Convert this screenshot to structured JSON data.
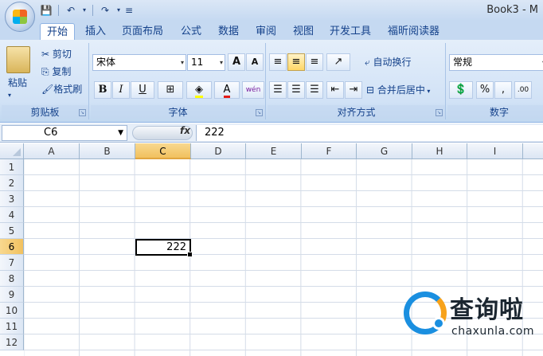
{
  "window": {
    "title": "Book3 - M"
  },
  "qat": {
    "save_icon": "save-icon",
    "undo_icon": "undo-icon",
    "redo_icon": "redo-icon"
  },
  "tabs": [
    "开始",
    "插入",
    "页面布局",
    "公式",
    "数据",
    "审阅",
    "视图",
    "开发工具",
    "福昕阅读器"
  ],
  "clipboard": {
    "paste": "粘贴",
    "cut": "剪切",
    "copy": "复制",
    "format_painter": "格式刷",
    "label": "剪贴板"
  },
  "font": {
    "name": "宋体",
    "size": "11",
    "label": "字体",
    "bold": "B",
    "italic": "I",
    "underline": "U",
    "grow": "A",
    "shrink": "A",
    "wen": "wén"
  },
  "alignment": {
    "wrap": "自动换行",
    "merge": "合并后居中",
    "label": "对齐方式"
  },
  "number": {
    "format": "常规",
    "percent": "%",
    "comma": ",",
    "label": "数字"
  },
  "formula_bar": {
    "name_box": "C6",
    "fx": "fx",
    "value": "222"
  },
  "sheet": {
    "columns": [
      "A",
      "B",
      "C",
      "D",
      "E",
      "F",
      "G",
      "H",
      "I"
    ],
    "rows": [
      "1",
      "2",
      "3",
      "4",
      "5",
      "6",
      "7",
      "8",
      "9",
      "10",
      "11",
      "12"
    ],
    "selected_column": "C",
    "selected_row": "6",
    "active_cell_value": "222"
  },
  "watermark": {
    "cn": "查询啦",
    "en": "chaxunla.com"
  },
  "colors": {
    "ribbon_accent": "#15428b",
    "selection_header": "#f1c15f",
    "watermark_blue": "#1a8fe0",
    "watermark_orange": "#f7a21b"
  }
}
